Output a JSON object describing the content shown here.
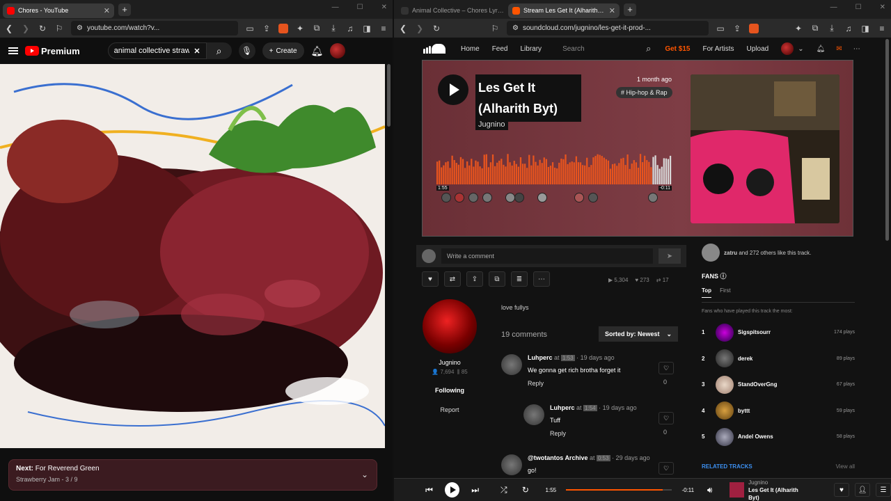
{
  "youtube": {
    "tabs": [
      {
        "title": "Chores - YouTube"
      }
    ],
    "url": "youtube.com/watch?v...",
    "header": {
      "brand": "Premium",
      "search_value": "animal collective strawb",
      "create_label": "Create"
    },
    "next": {
      "label": "Next:",
      "title": "For Reverend Green",
      "playlist": "Strawberry Jam - 3 / 9"
    }
  },
  "soundcloud": {
    "tabs": [
      {
        "title": "Animal Collective – Chores Lyrics | Ge"
      },
      {
        "title": "Stream Les Get It (Alharith Byt) by Jugnino"
      }
    ],
    "url": "soundcloud.com/jugnino/les-get-it-prod-...",
    "nav": {
      "home": "Home",
      "feed": "Feed",
      "library": "Library",
      "search_placeholder": "Search",
      "get": "Get $15",
      "artists": "For Artists",
      "upload": "Upload"
    },
    "track": {
      "title": "Les Get It (Alharith Byt)",
      "artist": "Jugnino",
      "ago": "1 month ago",
      "tag": "# Hip-hop & Rap",
      "elapsed": "1:55",
      "remaining": "-0:11",
      "progress": 0.91
    },
    "comment_placeholder": "Write a comment",
    "stats": {
      "plays": "5,304",
      "likes": "273",
      "reposts": "17"
    },
    "uploader": {
      "name": "Jugnino",
      "followers": "7,694",
      "tracks": "85",
      "follow_label": "Following",
      "report_label": "Report"
    },
    "description": "love fullys",
    "comments_count": "19 comments",
    "sort_label": "Sorted by: Newest",
    "comments": [
      {
        "user": "Luhperc",
        "at": " at ",
        "ts": "1:53",
        "ago": " · 19 days ago",
        "text": "We gonna get rich brotha forget it",
        "reply": "Reply",
        "count": "0"
      },
      {
        "user": "Luhperc",
        "at": " at ",
        "ts": "1:54",
        "ago": " · 19 days ago",
        "text": "Tuff",
        "reply": "Reply",
        "count": "0"
      },
      {
        "user": "@twotantos Archive",
        "at": " at ",
        "ts": "0:53",
        "ago": " · 29 days ago",
        "text": "go!",
        "reply": "Reply",
        "count": "0"
      }
    ],
    "likers": {
      "name": "zatru",
      "rest": " and 272 others like this track."
    },
    "fans": {
      "title": "FANS ⓘ",
      "tab_top": "Top",
      "tab_first": "First",
      "subtitle": "Fans who have played this track the most:",
      "list": [
        {
          "rank": "1",
          "name": "Sigspitsourr",
          "plays": "174 plays"
        },
        {
          "rank": "2",
          "name": "derek",
          "plays": "89 plays"
        },
        {
          "rank": "3",
          "name": "StandOverGng",
          "plays": "67 plays"
        },
        {
          "rank": "4",
          "name": "byttt",
          "plays": "59 plays"
        },
        {
          "rank": "5",
          "name": "Andel Owens",
          "plays": "58 plays"
        }
      ]
    },
    "related": {
      "title": "RELATED TRACKS",
      "view_all": "View all"
    },
    "player": {
      "elapsed": "1:55",
      "remaining": "-0:11",
      "artist": "Jugnino",
      "title": "Les Get It (Alharith Byt)"
    }
  },
  "colors": {
    "accent": "#ff5500",
    "yt_red": "#ff0000",
    "link_blue": "#3c8ff0"
  }
}
